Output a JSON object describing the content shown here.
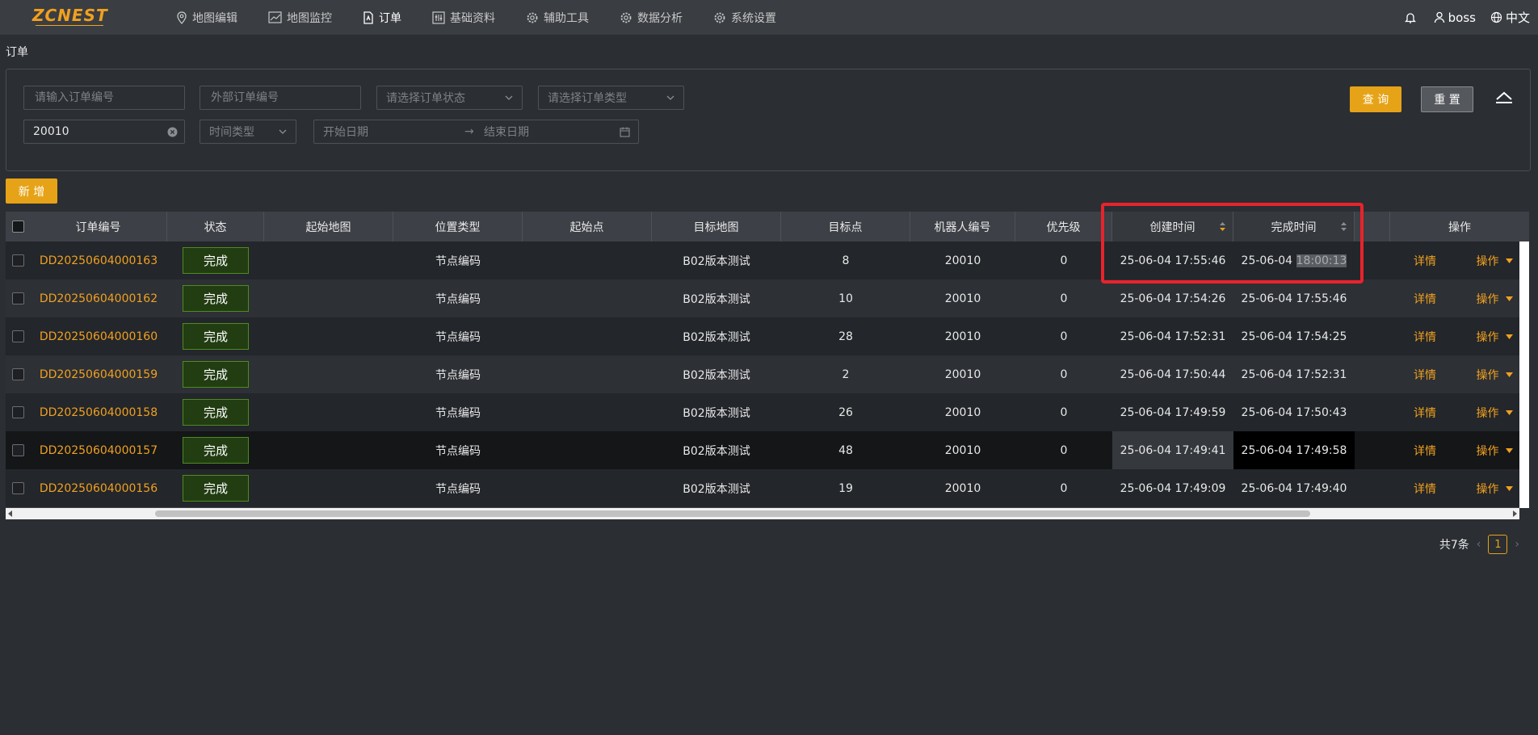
{
  "brand": {
    "logo_text": "ZCNEST"
  },
  "nav": {
    "items": [
      {
        "label": "地图编辑",
        "icon": "map-pin-icon"
      },
      {
        "label": "地图监控",
        "icon": "chart-line-icon"
      },
      {
        "label": "订单",
        "icon": "document-icon",
        "active": true
      },
      {
        "label": "基础资料",
        "icon": "sliders-icon"
      },
      {
        "label": "辅助工具",
        "icon": "gear-icon"
      },
      {
        "label": "数据分析",
        "icon": "gear-icon"
      },
      {
        "label": "系统设置",
        "icon": "gear-icon"
      }
    ]
  },
  "header_right": {
    "user": "boss",
    "language": "中文"
  },
  "page": {
    "title": "订单"
  },
  "filters": {
    "order_no_placeholder": "请输入订单编号",
    "external_no_placeholder": "外部订单编号",
    "status_placeholder": "请选择订单状态",
    "type_placeholder": "请选择订单类型",
    "robot_value": "20010",
    "time_type_placeholder": "时间类型",
    "start_date_placeholder": "开始日期",
    "end_date_placeholder": "结束日期",
    "range_separator": "→",
    "query_label": "查 询",
    "reset_label": "重 置"
  },
  "actions": {
    "add_label": "新 增"
  },
  "table": {
    "columns": [
      "订单编号",
      "状态",
      "起始地图",
      "位置类型",
      "起始点",
      "目标地图",
      "目标点",
      "机器人编号",
      "优先级",
      "创建时间",
      "完成时间",
      "操作"
    ],
    "rows": [
      {
        "order_no": "DD20250604000163",
        "status": "完成",
        "start_map": "",
        "position_type": "节点编码",
        "start_point": "",
        "target_map": "B02版本测试",
        "target_point": "8",
        "robot_no": "20010",
        "priority": "0",
        "created": "25-06-04 17:55:46",
        "finished_date": "25-06-04",
        "finished_time": "18:00:13"
      },
      {
        "order_no": "DD20250604000162",
        "status": "完成",
        "start_map": "",
        "position_type": "节点编码",
        "start_point": "",
        "target_map": "B02版本测试",
        "target_point": "10",
        "robot_no": "20010",
        "priority": "0",
        "created": "25-06-04 17:54:26",
        "finished_date": "25-06-04",
        "finished_time": "17:55:46"
      },
      {
        "order_no": "DD20250604000160",
        "status": "完成",
        "start_map": "",
        "position_type": "节点编码",
        "start_point": "",
        "target_map": "B02版本测试",
        "target_point": "28",
        "robot_no": "20010",
        "priority": "0",
        "created": "25-06-04 17:52:31",
        "finished_date": "25-06-04",
        "finished_time": "17:54:25"
      },
      {
        "order_no": "DD20250604000159",
        "status": "完成",
        "start_map": "",
        "position_type": "节点编码",
        "start_point": "",
        "target_map": "B02版本测试",
        "target_point": "2",
        "robot_no": "20010",
        "priority": "0",
        "created": "25-06-04 17:50:44",
        "finished_date": "25-06-04",
        "finished_time": "17:52:31"
      },
      {
        "order_no": "DD20250604000158",
        "status": "完成",
        "start_map": "",
        "position_type": "节点编码",
        "start_point": "",
        "target_map": "B02版本测试",
        "target_point": "26",
        "robot_no": "20010",
        "priority": "0",
        "created": "25-06-04 17:49:59",
        "finished_date": "25-06-04",
        "finished_time": "17:50:43"
      },
      {
        "order_no": "DD20250604000157",
        "status": "完成",
        "start_map": "",
        "position_type": "节点编码",
        "start_point": "",
        "target_map": "B02版本测试",
        "target_point": "48",
        "robot_no": "20010",
        "priority": "0",
        "created": "25-06-04 17:49:41",
        "finished_date": "25-06-04",
        "finished_time": "17:49:58"
      },
      {
        "order_no": "DD20250604000156",
        "status": "完成",
        "start_map": "",
        "position_type": "节点编码",
        "start_point": "",
        "target_map": "B02版本测试",
        "target_point": "19",
        "robot_no": "20010",
        "priority": "0",
        "created": "25-06-04 17:49:09",
        "finished_date": "25-06-04",
        "finished_time": "17:49:40"
      }
    ],
    "detail_label": "详情",
    "op_label": "操作"
  },
  "pagination": {
    "total_text": "共7条",
    "current_page": "1"
  },
  "colors": {
    "accent": "#e6a317",
    "status_bg": "#223d12",
    "highlight_box": "#e8232c"
  }
}
